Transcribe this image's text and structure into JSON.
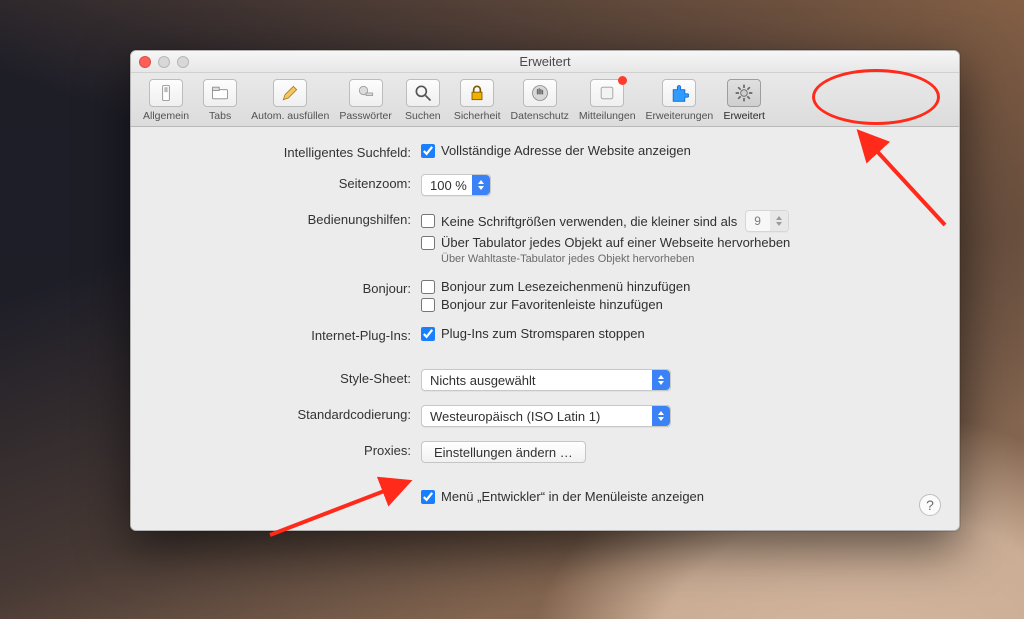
{
  "window": {
    "title": "Erweitert"
  },
  "toolbar": {
    "items": [
      {
        "key": "general",
        "label": "Allgemein"
      },
      {
        "key": "tabs",
        "label": "Tabs"
      },
      {
        "key": "autofill",
        "label": "Autom. ausfüllen"
      },
      {
        "key": "passwords",
        "label": "Passwörter"
      },
      {
        "key": "search",
        "label": "Suchen"
      },
      {
        "key": "security",
        "label": "Sicherheit"
      },
      {
        "key": "privacy",
        "label": "Datenschutz"
      },
      {
        "key": "notifications",
        "label": "Mitteilungen",
        "badge": true
      },
      {
        "key": "extensions",
        "label": "Erweiterungen"
      },
      {
        "key": "advanced",
        "label": "Erweitert",
        "selected": true
      }
    ]
  },
  "fields": {
    "smart_search": {
      "label": "Intelligentes Suchfeld:",
      "full_url_checkbox": {
        "checked": true,
        "text": "Vollständige Adresse der Website anzeigen"
      }
    },
    "page_zoom": {
      "label": "Seitenzoom:",
      "value": "100 %"
    },
    "accessibility": {
      "label": "Bedienungshilfen:",
      "min_font_checkbox": {
        "checked": false,
        "text": "Keine Schriftgrößen verwenden, die kleiner sind als"
      },
      "min_font_value": "9",
      "tab_highlight_checkbox": {
        "checked": false,
        "text": "Über Tabulator jedes Objekt auf einer Webseite hervorheben"
      },
      "tab_highlight_hint": "Über Wahltaste-Tabulator jedes Objekt hervorheben"
    },
    "bonjour": {
      "label": "Bonjour:",
      "bookmarks_checkbox": {
        "checked": false,
        "text": "Bonjour zum Lesezeichenmenü hinzufügen"
      },
      "favorites_checkbox": {
        "checked": false,
        "text": "Bonjour zur Favoritenleiste hinzufügen"
      }
    },
    "plugins": {
      "label": "Internet-Plug-Ins:",
      "powersave_checkbox": {
        "checked": true,
        "text": "Plug-Ins zum Stromsparen stoppen"
      }
    },
    "stylesheet": {
      "label": "Style-Sheet:",
      "value": "Nichts ausgewählt"
    },
    "encoding": {
      "label": "Standardcodierung:",
      "value": "Westeuropäisch (ISO Latin 1)"
    },
    "proxies": {
      "label": "Proxies:",
      "button": "Einstellungen ändern …"
    },
    "developer_menu": {
      "checked": true,
      "text": "Menü „Entwickler“ in der Menüleiste anzeigen"
    }
  },
  "help_button": "?",
  "colors": {
    "accent": "#1a7fff",
    "annotation": "#ff2a1a"
  }
}
